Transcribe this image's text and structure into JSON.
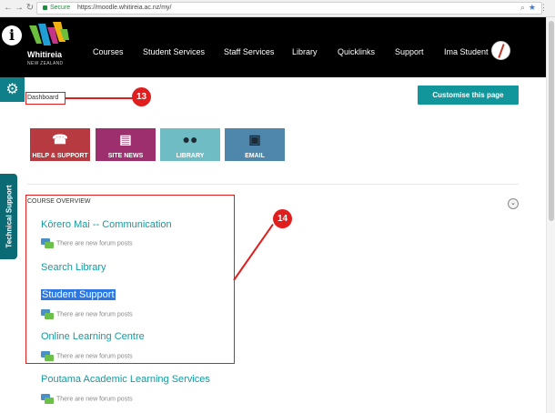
{
  "browser": {
    "secure_label": "Secure",
    "url": "https://moodle.whitireia.ac.nz/my/"
  },
  "header": {
    "logo_name": "Whitireia",
    "logo_sub": "NEW ZEALAND",
    "nav": [
      "Courses",
      "Student Services",
      "Staff Services",
      "Library",
      "Quicklinks",
      "Support"
    ],
    "user_name": "Ima Student"
  },
  "sidebar": {
    "tech_support_label": "Technical Support"
  },
  "page": {
    "breadcrumb": "Dashboard",
    "customise_label": "Customise this page",
    "callout_13": "13",
    "callout_14": "14"
  },
  "quicklinks": [
    {
      "label": "HELP & SUPPORT",
      "icon": "phone-icon",
      "color": "#b63a40"
    },
    {
      "label": "SITE NEWS",
      "icon": "chat-icon",
      "color": "#9e2f6e"
    },
    {
      "label": "LIBRARY",
      "icon": "people-icon",
      "color": "#6fbcc4"
    },
    {
      "label": "EMAIL",
      "icon": "printer-icon",
      "color": "#4f86ab"
    }
  ],
  "overview": {
    "title": "COURSE OVERVIEW",
    "courses": [
      {
        "name": "Kōrero Mai -- Communication",
        "forum": "There are new forum posts"
      },
      {
        "name": "Search Library",
        "forum": ""
      },
      {
        "name": "Student Support",
        "forum": "There are new forum posts"
      },
      {
        "name": "Online Learning Centre",
        "forum": "There are new forum posts"
      },
      {
        "name": "Poutama Academic Learning Services",
        "forum": "There are new forum posts"
      }
    ]
  },
  "colors": {
    "accent": "#11979b",
    "annotation": "#e01e1e",
    "header_bg": "#000000"
  }
}
